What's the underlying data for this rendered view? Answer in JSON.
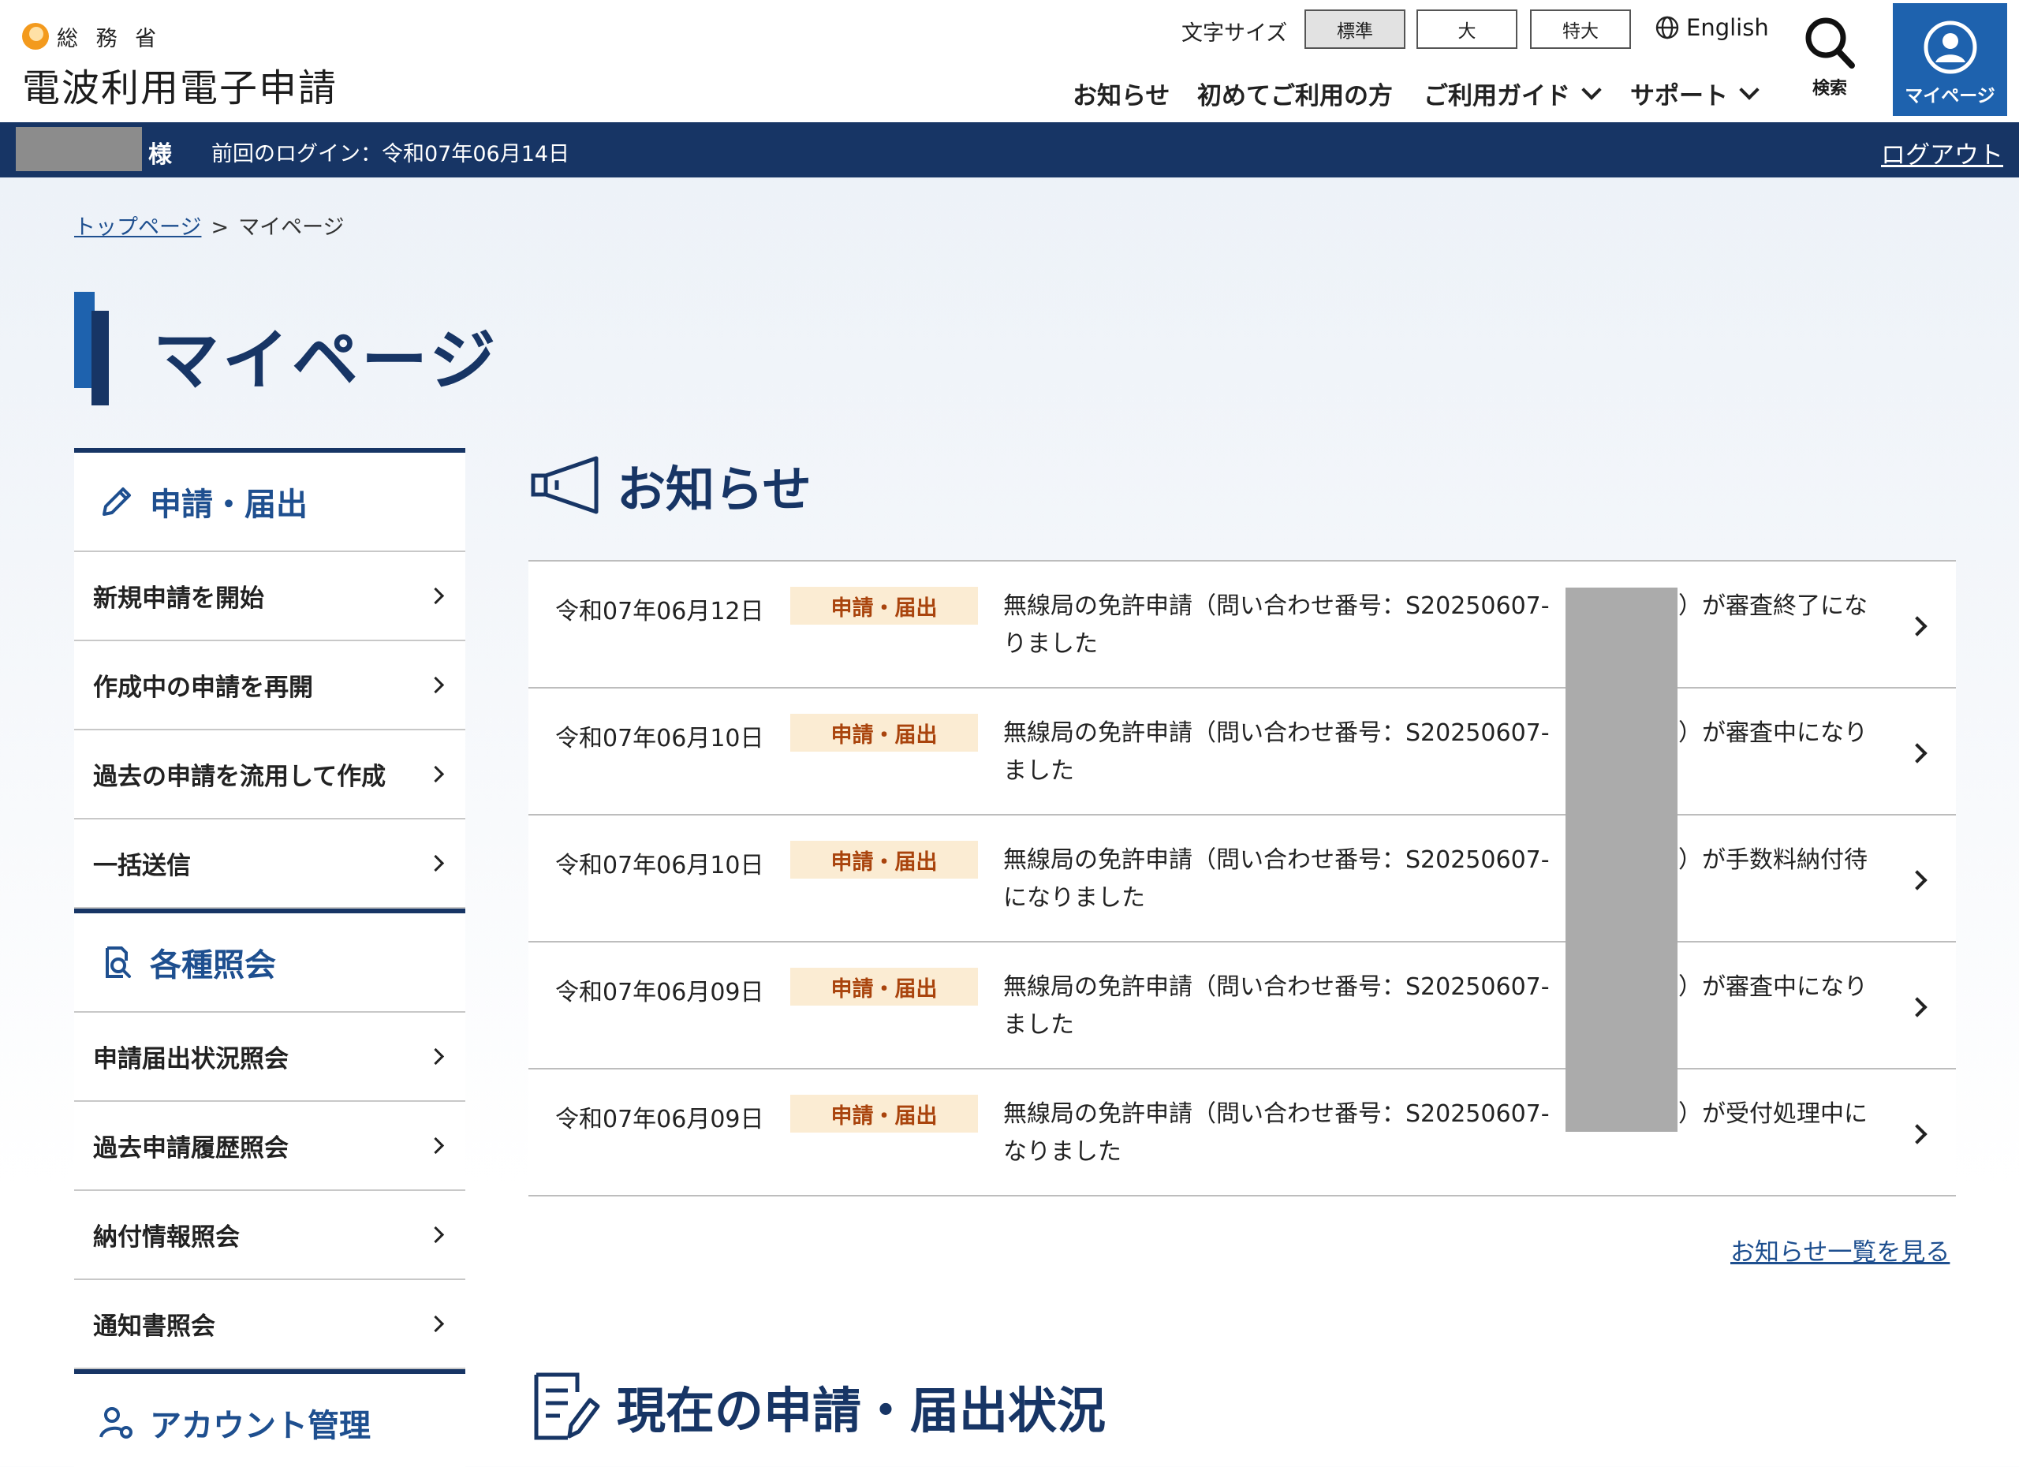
{
  "header": {
    "ministry": "総 務 省",
    "site_name": "電波利用電子申請",
    "font_size_label": "文字サイズ",
    "font_sizes": [
      "標準",
      "大",
      "特大"
    ],
    "language": "English",
    "nav": [
      "お知らせ",
      "初めてご利用の方",
      "ご利用ガイド",
      "サポート"
    ],
    "search_label": "検索",
    "mypage_label": "マイページ"
  },
  "userbar": {
    "honorific": "様",
    "last_login": "前回のログイン：令和07年06月14日",
    "logout": "ログアウト"
  },
  "breadcrumb": {
    "home": "トップページ",
    "current": "マイページ"
  },
  "page_title": "マイページ",
  "sidebar": {
    "sections": [
      {
        "title": "申請・届出",
        "icon": "pencil-icon",
        "items": [
          "新規申請を開始",
          "作成中の申請を再開",
          "過去の申請を流用して作成",
          "一括送信"
        ]
      },
      {
        "title": "各種照会",
        "icon": "document-search-icon",
        "items": [
          "申請届出状況照会",
          "過去申請履歴照会",
          "納付情報照会",
          "通知書照会"
        ]
      },
      {
        "title": "アカウント管理",
        "icon": "user-gear-icon",
        "items": []
      }
    ]
  },
  "news": {
    "title": "お知らせ",
    "items": [
      {
        "date": "令和07年06月12日",
        "tag": "申請・届出",
        "text_a": "無線局の免許申請（問い合わせ番号：S20250607-",
        "text_b": "）が審査終了にな",
        "text_c": "りました"
      },
      {
        "date": "令和07年06月10日",
        "tag": "申請・届出",
        "text_a": "無線局の免許申請（問い合わせ番号：S20250607-",
        "text_b": "）が審査中になり",
        "text_c": "ました"
      },
      {
        "date": "令和07年06月10日",
        "tag": "申請・届出",
        "text_a": "無線局の免許申請（問い合わせ番号：S20250607-",
        "text_b": "）が手数料納付待",
        "text_c": "になりました"
      },
      {
        "date": "令和07年06月09日",
        "tag": "申請・届出",
        "text_a": "無線局の免許申請（問い合わせ番号：S20250607-",
        "text_b": "）が審査中になり",
        "text_c": "ました"
      },
      {
        "date": "令和07年06月09日",
        "tag": "申請・届出",
        "text_a": "無線局の免許申請（問い合わせ番号：S20250607-",
        "text_b": "）が受付処理中に",
        "text_c": "なりました"
      }
    ],
    "more_link": "お知らせ一覧を見る"
  },
  "status_section": {
    "title": "現在の申請・届出状況"
  },
  "colors": {
    "navy": "#173565",
    "blue": "#1e62ae",
    "tag_bg": "#fbecd3",
    "tag_text": "#a9440d",
    "logo_orange": "#f39a1d"
  }
}
